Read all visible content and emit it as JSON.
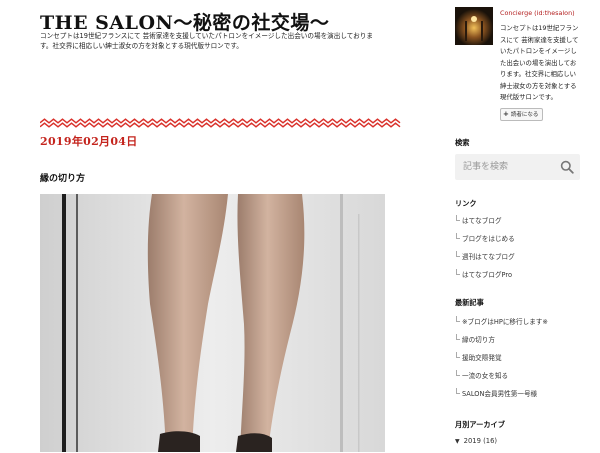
{
  "header": {
    "title": "THE SALON〜秘密の社交場〜",
    "description": "コンセプトは19世紀フランスにて 芸術家達を支援していたパトロンをイメージした出会いの場を演出しております。社交界に相応しい紳士淑女の方を対象とする現代版サロンです。"
  },
  "entry": {
    "date": "2019年02月04日",
    "title": "縁の切り方"
  },
  "sidebar": {
    "profile": {
      "name": "Concierge (id:thesalon)",
      "description": "コンセプトは19世紀フランスにて 芸術家達を支援していたパトロンをイメージした出会いの場を演出しております。社交界に相応しい紳士淑女の方を対象とする現代版サロンです。",
      "reader_button": "読者になる",
      "reader_plus": "+"
    },
    "search": {
      "heading": "検索",
      "placeholder": "記事を検索",
      "icon": "search-icon"
    },
    "links": {
      "heading": "リンク",
      "items": [
        "はてなブログ",
        "ブログをはじめる",
        "週刊はてなブログ",
        "はてなブログPro"
      ]
    },
    "recent": {
      "heading": "最新記事",
      "items": [
        "※ブログはHPに移行します※",
        "縁の切り方",
        "援助交際発覚",
        "一流の女を知る",
        "SALON会員男性第一号様"
      ]
    },
    "archive": {
      "heading": "月別アーカイブ",
      "year": "2019",
      "count": "(16)"
    }
  },
  "colors": {
    "accent_red": "#c4241d",
    "wave_red": "#d9302a",
    "profile_name": "#b32020"
  }
}
